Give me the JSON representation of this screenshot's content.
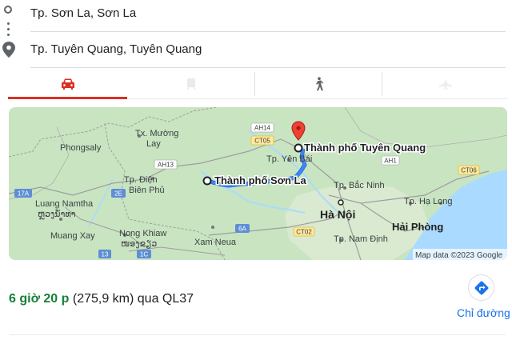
{
  "route": {
    "origin": "Tp. Sơn La, Sơn La",
    "destination": "Tp. Tuyên Quang, Tuyên Quang"
  },
  "tabs": [
    {
      "icon": "car-icon",
      "active": true
    },
    {
      "icon": "transit-icon",
      "active": false
    },
    {
      "icon": "walking-icon",
      "active": false
    },
    {
      "icon": "flight-icon",
      "active": false
    }
  ],
  "map": {
    "origin_label": "Thành phố Sơn La",
    "destination_label": "Thành phố Tuyên Quang",
    "capital_label": "Hà Nội",
    "places": {
      "phongsaly": "Phongsaly",
      "muong_lay_1": "Tx. Mường",
      "muong_lay_2": "Lay",
      "dien_bien_1": "Tp. Điện",
      "dien_bien_2": "Biên Phủ",
      "luang_namtha": "Luang Namtha",
      "luang_namtha_lao": "ຫຼວງນ້ຳທາ",
      "muang_xay": "Muang Xay",
      "nong_khiaw": "Nong Khiaw",
      "nong_khiaw_lao": "ໜອງຂຽວ",
      "xam_neua": "Xam Neua",
      "yen_bai": "Tp. Yên Bái",
      "bac_ninh": "Tp. Bắc Ninh",
      "ha_long": "Tp. Hạ Long",
      "hai_phong": "Hải Phòng",
      "nam_dinh": "Tp. Nam Định"
    },
    "shields": {
      "ah14": "AH14",
      "ct05": "CT05",
      "ah13": "AH13",
      "17a": "17A",
      "2e": "2E",
      "6a": "6A",
      "13": "13",
      "1c": "1C",
      "ct02": "CT02",
      "ah1": "AH1",
      "ct06": "CT06"
    },
    "attribution": "Map data ©2023 Google",
    "colors": {
      "route": "#4285f4",
      "pin": "#ea4335",
      "land": "#c7e3bf",
      "sea": "#aadaff"
    }
  },
  "summary": {
    "time": "6 giờ 20 p",
    "distance": "(275,9 km)",
    "via": "qua QL37"
  },
  "directions_button": {
    "icon": "directions-icon",
    "label": "Chỉ đường"
  }
}
